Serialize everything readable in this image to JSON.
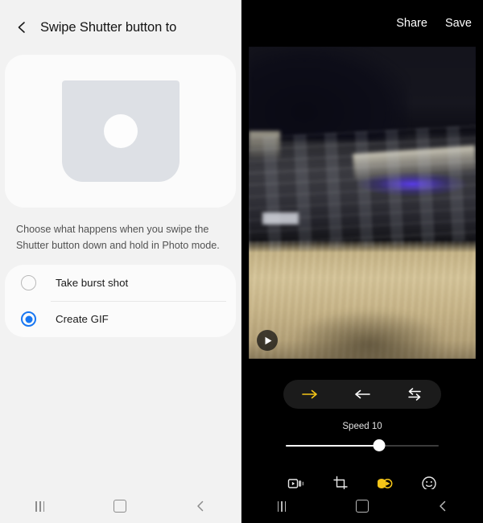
{
  "settings_panel": {
    "header": {
      "back_icon": "chevron-left-icon",
      "title": "Swipe Shutter button to"
    },
    "illustration": {
      "name": "shutter-button-illustration",
      "body_color": "#dde0e5",
      "button_color": "#fdfdfd"
    },
    "description": "Choose what happens when you swipe the Shutter button down and hold in Photo mode.",
    "options": [
      {
        "label": "Take burst shot",
        "selected": false
      },
      {
        "label": "Create GIF",
        "selected": true
      }
    ],
    "accent_color": "#1877f2",
    "navbar": {
      "recents_icon": "recents-icon",
      "home_icon": "home-icon",
      "back_icon": "back-icon"
    }
  },
  "editor_panel": {
    "header": {
      "share_label": "Share",
      "save_label": "Save"
    },
    "preview": {
      "name": "gif-preview",
      "play_icon": "play-icon"
    },
    "direction_buttons": [
      {
        "name": "play-forward-button",
        "icon": "arrow-right-icon",
        "active": true
      },
      {
        "name": "play-reverse-button",
        "icon": "arrow-left-icon",
        "active": false
      },
      {
        "name": "play-bounce-button",
        "icon": "swap-arrows-icon",
        "active": false
      }
    ],
    "speed": {
      "label": "Speed 10",
      "value": 10,
      "min": 1,
      "max": 16,
      "fill_percent": 61
    },
    "tools": [
      {
        "name": "trim-tool",
        "icon": "video-trim-icon",
        "active": false
      },
      {
        "name": "crop-tool",
        "icon": "crop-icon",
        "active": false
      },
      {
        "name": "speed-tool",
        "icon": "speed-icon",
        "active": true
      },
      {
        "name": "sticker-tool",
        "icon": "smiley-icon",
        "active": false
      }
    ],
    "active_color": "#f5c518",
    "navbar": {
      "recents_icon": "recents-icon",
      "home_icon": "home-icon",
      "back_icon": "back-icon"
    }
  }
}
